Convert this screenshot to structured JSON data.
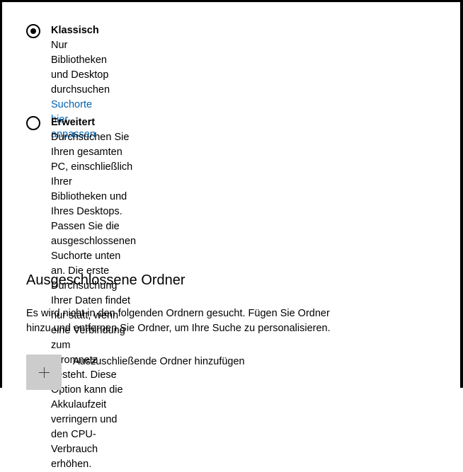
{
  "search_mode": {
    "classic": {
      "title": "Klassisch",
      "description": "Nur Bibliotheken und Desktop durchsuchen",
      "link": "Suchorte hier anpassen",
      "selected": true
    },
    "enhanced": {
      "title": "Erweitert",
      "description_lines": [
        "Durchsuchen Sie Ihren gesamten PC, einschließlich Ihrer",
        "Bibliotheken und Ihres Desktops. Passen Sie die",
        "ausgeschlossenen Suchorte unten an. Die erste Durchsuchung",
        "Ihrer Daten findet nur statt, wenn eine Verbindung zum",
        "Stromnetz besteht. Diese Option kann die Akkulaufzeit",
        "verringern und den CPU-Verbrauch erhöhen."
      ],
      "selected": false
    }
  },
  "excluded_folders": {
    "heading": "Ausgeschlossene Ordner",
    "description_lines": [
      "Es wird nicht in den folgenden Ordnern gesucht. Fügen Sie Ordner",
      "hinzu und entfernen Sie Ordner, um Ihre Suche zu personalisieren."
    ],
    "add_label": "Auszuschließende Ordner hinzufügen",
    "add_icon": "plus-icon"
  }
}
